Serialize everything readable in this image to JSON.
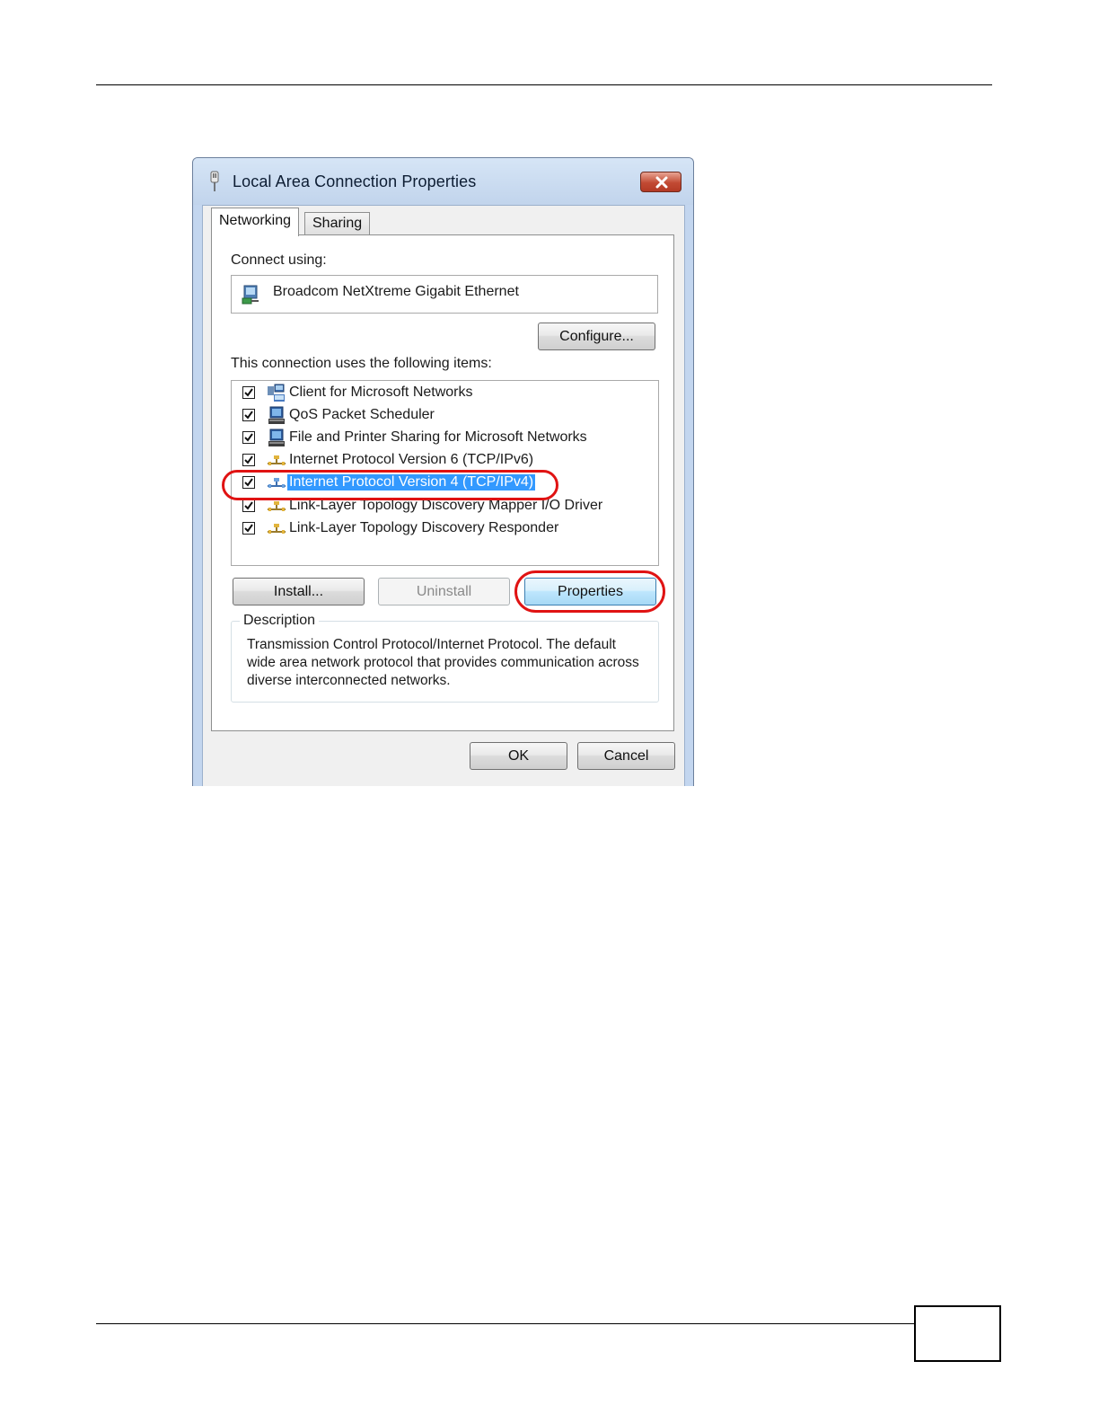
{
  "page": {
    "page_number": ""
  },
  "dialog": {
    "title": "Local Area Connection Properties",
    "tabs": [
      {
        "label": "Networking",
        "active": true
      },
      {
        "label": "Sharing",
        "active": false
      }
    ],
    "connect_using_label": "Connect using:",
    "adapter": "Broadcom NetXtreme Gigabit Ethernet",
    "configure_button": "Configure...",
    "items_label": "This connection uses the following items:",
    "items": [
      {
        "label": "Client for Microsoft Networks",
        "checked": true,
        "icon": "network-client-icon"
      },
      {
        "label": "QoS Packet Scheduler",
        "checked": true,
        "icon": "service-icon"
      },
      {
        "label": "File and Printer Sharing for Microsoft Networks",
        "checked": true,
        "icon": "service-icon"
      },
      {
        "label": "Internet Protocol Version 6 (TCP/IPv6)",
        "checked": true,
        "icon": "protocol-icon"
      },
      {
        "label": "Internet Protocol Version 4 (TCP/IPv4)",
        "checked": true,
        "icon": "protocol-icon",
        "selected": true
      },
      {
        "label": "Link-Layer Topology Discovery Mapper I/O Driver",
        "checked": true,
        "icon": "protocol-icon"
      },
      {
        "label": "Link-Layer Topology Discovery Responder",
        "checked": true,
        "icon": "protocol-icon"
      }
    ],
    "install_button": "Install...",
    "uninstall_button": "Uninstall",
    "properties_button": "Properties",
    "description_title": "Description",
    "description_text": "Transmission Control Protocol/Internet Protocol. The default wide area network protocol that provides communication across diverse interconnected networks.",
    "ok_button": "OK",
    "cancel_button": "Cancel"
  },
  "colors": {
    "highlight_ring": "#e01313",
    "selection": "#3399ff",
    "titlebar": "#c3d6ef"
  }
}
